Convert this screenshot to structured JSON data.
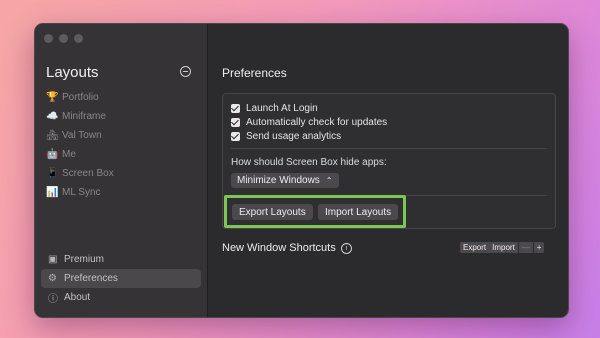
{
  "sidebar": {
    "title": "Layouts",
    "items": [
      {
        "icon": "🏆",
        "label": "Portfolio"
      },
      {
        "icon": "☁️",
        "label": "Miniframe"
      },
      {
        "icon": "🏘",
        "label": "Val Town"
      },
      {
        "icon": "🤖",
        "label": "Me"
      },
      {
        "icon": "📱",
        "label": "Screen Box"
      },
      {
        "icon": "📊",
        "label": "ML Sync"
      }
    ],
    "footer": [
      {
        "icon": "▣",
        "label": "Premium"
      },
      {
        "icon": "⚙",
        "label": "Preferences"
      },
      {
        "icon": "ⓘ",
        "label": "About"
      }
    ]
  },
  "main": {
    "title": "Preferences",
    "checkboxes": [
      {
        "label": "Launch At Login",
        "checked": true
      },
      {
        "label": "Automatically check for updates",
        "checked": true
      },
      {
        "label": "Send usage analytics",
        "checked": true
      }
    ],
    "hide_question": "How should Screen Box hide apps:",
    "hide_select": "Minimize Windows",
    "export_layouts": "Export Layouts",
    "import_layouts": "Import Layouts",
    "shortcuts_title": "New Window Shortcuts",
    "shortcuts_export": "Export",
    "shortcuts_import": "Import",
    "minus": "—",
    "plus": "+"
  },
  "colors": {
    "highlight": "#7cc657"
  }
}
